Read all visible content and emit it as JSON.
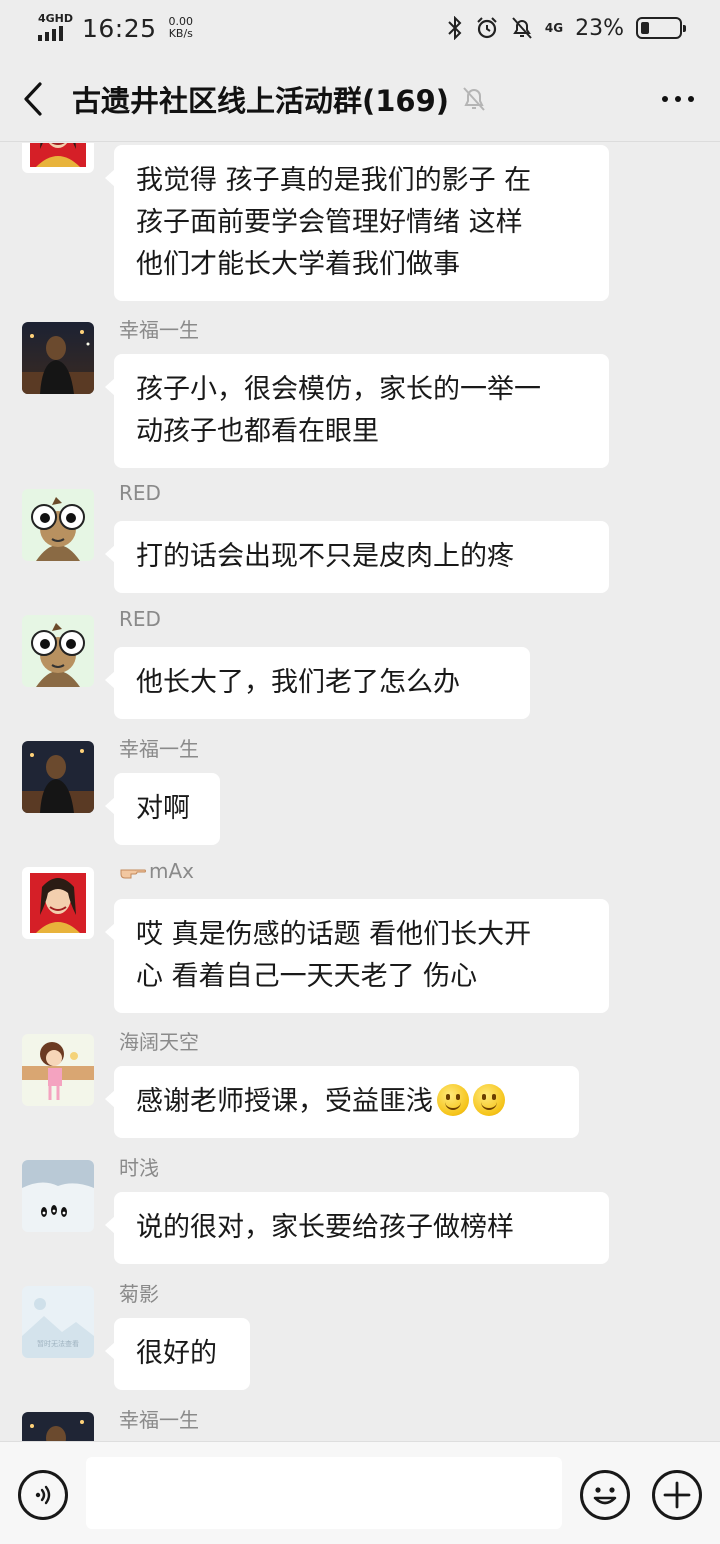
{
  "status_bar": {
    "network": "4GHD",
    "time": "16:25",
    "speed_value": "0.00",
    "speed_unit": "KB/s",
    "network_right": "4G",
    "battery_percent": "23%",
    "battery_level": 0.23
  },
  "header": {
    "title": "古遗井社区线上活动群(169)",
    "back_icon": "chevron-left-icon",
    "mute_icon": "bell-muted-icon",
    "more_icon": "more-dots-icon"
  },
  "messages": [
    {
      "sender": "",
      "avatar": "portrait-woman-red",
      "lines": [
        "我觉得 孩子真的是我们的影子 在",
        "孩子面前要学会管理好情绪 这样",
        "他们才能长大学着我们做事"
      ]
    },
    {
      "sender": "幸福一生",
      "avatar": "night-street-photo",
      "lines": [
        "孩子小，很会模仿，家长的一举一",
        "动孩子也都看在眼里"
      ]
    },
    {
      "sender": "RED",
      "avatar": "cartoon-monkey",
      "lines": [
        "打的话会出现不只是皮肉上的疼"
      ]
    },
    {
      "sender": "RED",
      "avatar": "cartoon-monkey",
      "lines": [
        "他长大了，我们老了怎么办"
      ]
    },
    {
      "sender": "幸福一生",
      "avatar": "night-street-photo",
      "lines": [
        "对啊"
      ]
    },
    {
      "sender": "mAx",
      "avatar": "portrait-woman-red",
      "lines": [
        "哎 真是伤感的话题 看他们长大开",
        "心 看着自己一天天老了 伤心"
      ]
    },
    {
      "sender": "海阔天空",
      "avatar": "cartoon-girl",
      "lines": [
        "感谢老师授课，受益匪浅"
      ]
    },
    {
      "sender": "时浅",
      "avatar": "penguins-snow",
      "lines": [
        "说的很对，家长要给孩子做榜样"
      ]
    },
    {
      "sender": "菊影",
      "avatar": "placeholder-image",
      "avatar_caption": "暂时无法查看",
      "lines": [
        "很好的"
      ]
    },
    {
      "sender": "幸福一生",
      "avatar": "night-street-photo",
      "lines": []
    }
  ],
  "input_bar": {
    "voice_icon": "voice-icon",
    "text_value": "",
    "emoji_icon": "emoji-icon",
    "plus_icon": "plus-icon"
  }
}
